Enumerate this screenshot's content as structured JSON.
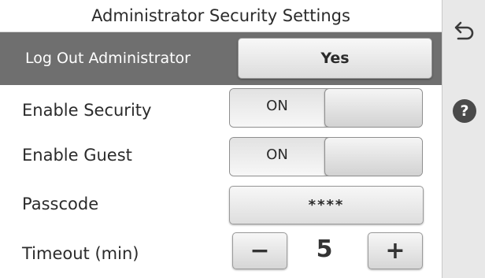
{
  "header": {
    "title": "Administrator Security Settings"
  },
  "logout": {
    "label": "Log Out Administrator",
    "button_label": "Yes"
  },
  "settings": {
    "enable_security": {
      "label": "Enable Security",
      "state": "ON"
    },
    "enable_guest": {
      "label": "Enable Guest",
      "state": "ON"
    },
    "passcode": {
      "label": "Passcode",
      "value": "****"
    },
    "timeout": {
      "label": "Timeout (min)",
      "value": "5",
      "decrement": "−",
      "increment": "+"
    }
  },
  "sidebar": {
    "back_icon": "back-arrow-icon",
    "help_icon": "help-icon",
    "help_glyph": "?"
  },
  "colors": {
    "highlight_row": "#6f6f6f",
    "sidebar_bg": "#e8e8e8",
    "text": "#2b2b2b"
  }
}
